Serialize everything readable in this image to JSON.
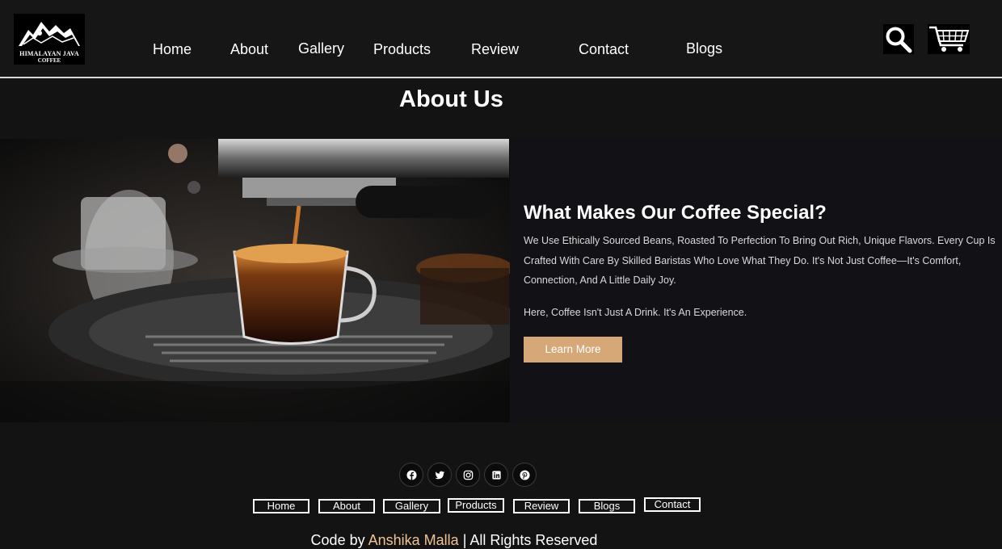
{
  "header": {
    "logo": {
      "line1": "HIMALAYAN JAVA",
      "line2": "COFFEE"
    },
    "nav": [
      "Home",
      "About",
      "Gallery",
      "Products",
      "Review",
      "Contact",
      "Blogs"
    ],
    "icons": [
      "search-icon",
      "cart-icon"
    ]
  },
  "page_title": "About Us",
  "hero": {
    "heading": "What Makes Our Coffee Special?",
    "paragraph1": "We Use Ethically Sourced Beans, Roasted To Perfection To Bring Out Rich, Unique Flavors. Every Cup Is Crafted With Care By Skilled Baristas Who Love What They Do. It's Not Just Coffee—It's Comfort, Connection, And A Little Daily Joy.",
    "paragraph2": "Here, Coffee Isn't Just A Drink. It's An Experience.",
    "button_label": "Learn More"
  },
  "footer": {
    "social": [
      "facebook-icon",
      "twitter-icon",
      "instagram-icon",
      "linkedin-icon",
      "pinterest-icon"
    ],
    "nav": [
      "Home",
      "About",
      "Gallery",
      "Products",
      "Review",
      "Blogs",
      "Contact"
    ],
    "credit_prefix": "Code by",
    "credit_name": "Anshika Malla",
    "credit_suffix": "| All Rights Reserved"
  },
  "colors": {
    "background": "#131313",
    "accent": "#d6a878",
    "credit_name": "#f2c294"
  }
}
